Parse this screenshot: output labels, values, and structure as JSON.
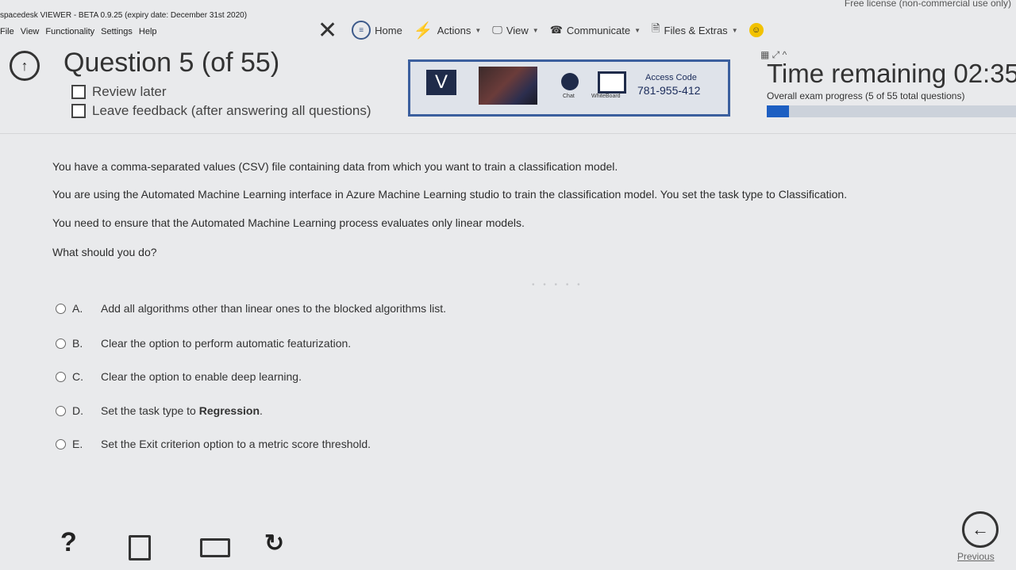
{
  "window": {
    "license_text": "Free license (non-commercial use only)",
    "title": "spacedesk VIEWER - BETA 0.9.25 (expiry date: December 31st 2020)",
    "menu": [
      "File",
      "View",
      "Functionality",
      "Settings",
      "Help"
    ]
  },
  "toolbar": {
    "home": "Home",
    "actions": "Actions",
    "view": "View",
    "communicate": "Communicate",
    "files": "Files & Extras"
  },
  "remote_panel": {
    "v_label": "V",
    "chat": "Chat",
    "whiteboard": "WhiteBoard",
    "access_label": "Access Code",
    "access_code": "781-955-412"
  },
  "header": {
    "question_title": "Question 5 (of 55)",
    "review_later": "Review later",
    "leave_feedback": "Leave feedback (after answering all questions)",
    "time_remaining": "Time remaining 02:35",
    "progress_text": "Overall exam progress (5 of 55 total questions)",
    "progress_fraction": 0.09
  },
  "question": {
    "paragraphs": [
      "You have a comma-separated values (CSV) file containing data from which you want to train a classification model.",
      "You are using the Automated Machine Learning interface in Azure Machine Learning studio to train the classification model. You set the task type to Classification.",
      "You need to ensure that the Automated Machine Learning process evaluates only linear models.",
      "What should you do?"
    ],
    "options": [
      {
        "letter": "A.",
        "text": "Add all algorithms other than linear ones to the blocked algorithms list."
      },
      {
        "letter": "B.",
        "text": "Clear the option to perform automatic featurization."
      },
      {
        "letter": "C.",
        "text": "Clear the option to enable deep learning."
      },
      {
        "letter": "D.",
        "text_prefix": "Set the task type to ",
        "text_bold": "Regression",
        "text_suffix": "."
      },
      {
        "letter": "E.",
        "text": "Set the Exit criterion option to a metric score threshold."
      }
    ]
  },
  "footer": {
    "help": "?",
    "previous": "Previous"
  }
}
